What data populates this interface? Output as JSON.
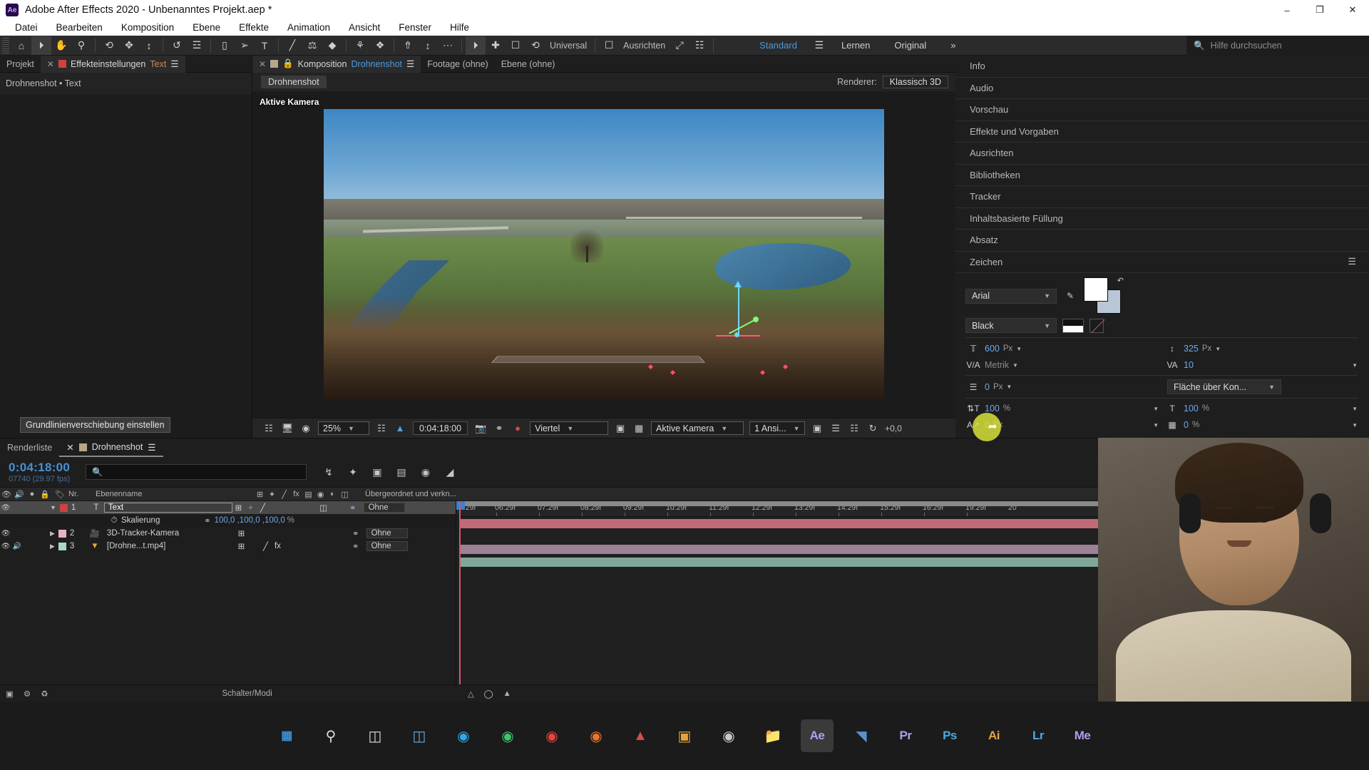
{
  "window": {
    "title": "Adobe After Effects 2020 - Unbenanntes Projekt.aep *",
    "logo": "ae-logo",
    "minimize": "–",
    "maximize": "❐",
    "close": "✕"
  },
  "menubar": {
    "items": [
      "Datei",
      "Bearbeiten",
      "Komposition",
      "Ebene",
      "Effekte",
      "Animation",
      "Ansicht",
      "Fenster",
      "Hilfe"
    ]
  },
  "toolbar": {
    "universal_label": "Universal",
    "snapping_label": "Ausrichten",
    "workspaces": [
      {
        "label": "Standard",
        "active": true
      },
      {
        "label": "Lernen",
        "active": false
      },
      {
        "label": "Original",
        "active": false
      }
    ],
    "overflow": "»",
    "help_placeholder": "Hilfe durchsuchen",
    "icons": [
      "pen-tool-icon",
      "selection-tool-icon",
      "hand-tool-icon",
      "zoom-tool-icon",
      "rotation-tool-icon",
      "anchor-point-tool-icon",
      "pan-behind-tool-icon",
      "roto-brush-icon",
      "puppet-pin-icon",
      "shape-tool-icon",
      "brush-tool-icon",
      "type-tool-icon",
      "clone-stamp-icon",
      "eraser-tool-icon",
      "mask-tool-icon",
      "puppet-tool-icon",
      "camera-tool-icon",
      "orbit-camera-icon",
      "pan-camera-icon",
      "dolly-camera-icon"
    ]
  },
  "left_panel": {
    "tabs": [
      {
        "label": "Projekt",
        "active": false,
        "closable": false
      },
      {
        "label": "Effekteinstellungen",
        "active": true,
        "closable": true,
        "accent": "Text"
      }
    ],
    "breadcrumb": "Drohnenshot • Text",
    "menu_icon": "panel-menu-icon"
  },
  "center_panel": {
    "tabs": [
      {
        "label": "Komposition",
        "active": true,
        "accent": "Drohnenshot"
      },
      {
        "label": "Footage (ohne)",
        "active": false
      },
      {
        "label": "Ebene (ohne)",
        "active": false
      }
    ],
    "comp_crumb": "Drohnenshot",
    "renderer_label": "Renderer:",
    "renderer_value": "Klassisch 3D",
    "camera_label": "Aktive Kamera",
    "viewer_toolbar": {
      "zoom": "25%",
      "time": "0:04:18:00",
      "resolution": "Viertel",
      "view": "Aktive Kamera",
      "views": "1 Ansi...",
      "offset": "+0,0",
      "icons": [
        "always-preview-icon",
        "monitor-icon",
        "3d-glasses-icon",
        "region-of-interest-icon",
        "transparency-grid-icon",
        "snapshot-icon",
        "show-snapshot-icon",
        "channel-icon",
        "mask-view-icon",
        "grid-icon",
        "guides-icon",
        "refresh-icon"
      ]
    }
  },
  "right_panel": {
    "panels": [
      "Info",
      "Audio",
      "Vorschau",
      "Effekte und Vorgaben",
      "Ausrichten",
      "Bibliotheken",
      "Tracker",
      "Inhaltsbasierte Füllung",
      "Absatz"
    ],
    "character": {
      "title": "Zeichen",
      "menu_icon": "panel-menu-icon",
      "font_family": "Arial",
      "font_style": "Black",
      "font_size": "600",
      "font_size_unit": "Px",
      "leading": "325",
      "leading_unit": "Px",
      "kerning": "Metrik",
      "tracking": "10",
      "stroke_width": "0",
      "stroke_width_unit": "Px",
      "stroke_type": "Fläche über Kon...",
      "vertical_scale": "100",
      "vertical_scale_unit": "%",
      "horizontal_scale": "100",
      "horizontal_scale_unit": "%",
      "baseline_shift": "0",
      "baseline_shift_unit": "Px",
      "tsume": "0",
      "tsume_unit": "%",
      "eyedropper_icon": "eyedropper-icon",
      "fill_swatch": "#ffffff",
      "stroke_swatch": "#b9c6d6",
      "tooltip": "Grundlinienverschiebung einstellen"
    }
  },
  "timeline": {
    "tabs": [
      {
        "label": "Renderliste",
        "active": false
      },
      {
        "label": "Drohnenshot",
        "active": true
      }
    ],
    "current_time": "0:04:18:00",
    "frame_info": "07740 (29.97 fps)",
    "search_placeholder": "",
    "header_icons": [
      "composition-mini-flowchart-icon",
      "draft-3d-icon",
      "hide-shy-layers-icon",
      "frame-blending-icon",
      "motion-blur-icon",
      "graph-editor-icon"
    ],
    "columns": [
      "Nr.",
      "Ebenenname",
      "Übergeordnet und verkn..."
    ],
    "column_icons": [
      "video-icon",
      "audio-icon",
      "solo-icon",
      "lock-icon",
      "label-icon",
      "parent-icon",
      "quality-icon",
      "effects-icon",
      "frame-blend-icon",
      "motion-blur-icon",
      "adjustment-icon",
      "3d-layer-icon"
    ],
    "layers": [
      {
        "index": "1",
        "name": "Text",
        "type_icon": "text-layer-icon",
        "color": "#d0413f",
        "selected": true,
        "parent": "Ohne",
        "bar_color": "#c06a78",
        "audio": false,
        "expanded": true
      },
      {
        "index": "2",
        "name": "3D-Tracker-Kamera",
        "type_icon": "camera-layer-icon",
        "color": "#e8b4c4",
        "selected": false,
        "parent": "Ohne",
        "bar_color": "#9b8296",
        "audio": false,
        "expanded": false
      },
      {
        "index": "3",
        "name": "[Drohne...t.mp4]",
        "type_icon": "video-layer-icon",
        "color": "#a8d8c8",
        "selected": false,
        "parent": "Ohne",
        "bar_color": "#7fa898",
        "audio": true,
        "expanded": false
      }
    ],
    "property_row": {
      "name": "Skalierung",
      "value": "100,0 ,100,0 ,100,0",
      "unit": "%",
      "link_icon": "constrain-proportions-icon",
      "stopwatch_icon": "stopwatch-icon"
    },
    "parent_default": "Ohne",
    "ruler_ticks": [
      "5:29f",
      "06:29f",
      "07:29f",
      "08:29f",
      "09:29f",
      "10:29f",
      "11:29f",
      "12:29f",
      "13:29f",
      "14:29f",
      "15:29f",
      "16:29f",
      "19:29f",
      "20"
    ],
    "footer_label": "Schalter/Modi",
    "footer_icons": [
      "new-composition-icon",
      "composition-settings-icon",
      "delete-icon"
    ]
  },
  "taskbar": {
    "items": [
      {
        "name": "start-button",
        "glyph": "⊞",
        "color": "#3b8fd4"
      },
      {
        "name": "search-icon",
        "glyph": "○",
        "color": "#dddddd"
      },
      {
        "name": "task-view-icon",
        "glyph": "▭",
        "color": "#dddddd"
      },
      {
        "name": "widgets-icon",
        "glyph": "▣",
        "color": "#6aa9e0"
      },
      {
        "name": "skype-icon",
        "glyph": "◉",
        "color": "#2fa8e8"
      },
      {
        "name": "whatsapp-icon",
        "glyph": "●",
        "color": "#3ec46d"
      },
      {
        "name": "opera-icon",
        "glyph": "●",
        "color": "#e8453c"
      },
      {
        "name": "firefox-icon",
        "glyph": "●",
        "color": "#e8762c"
      },
      {
        "name": "anydesk-icon",
        "glyph": "▲",
        "color": "#d0504a"
      },
      {
        "name": "explorer-orange-icon",
        "glyph": "■",
        "color": "#e8a33c"
      },
      {
        "name": "obs-icon",
        "glyph": "◎",
        "color": "#c8c8c8"
      },
      {
        "name": "file-explorer-icon",
        "glyph": "▰",
        "color": "#e8b44c"
      },
      {
        "name": "after-effects-icon",
        "glyph": "Ae",
        "color": "#b49cf0",
        "active": true
      },
      {
        "name": "media-encoder-blue-icon",
        "glyph": "◤",
        "color": "#5a8fd0"
      },
      {
        "name": "premiere-pro-icon",
        "glyph": "Pr",
        "color": "#b49cf0"
      },
      {
        "name": "photoshop-icon",
        "glyph": "Ps",
        "color": "#4aa8e8"
      },
      {
        "name": "illustrator-icon",
        "glyph": "Ai",
        "color": "#e8a33c"
      },
      {
        "name": "lightroom-icon",
        "glyph": "Lr",
        "color": "#4aa8e8"
      },
      {
        "name": "media-encoder-icon",
        "glyph": "Me",
        "color": "#b49cf0"
      }
    ]
  }
}
